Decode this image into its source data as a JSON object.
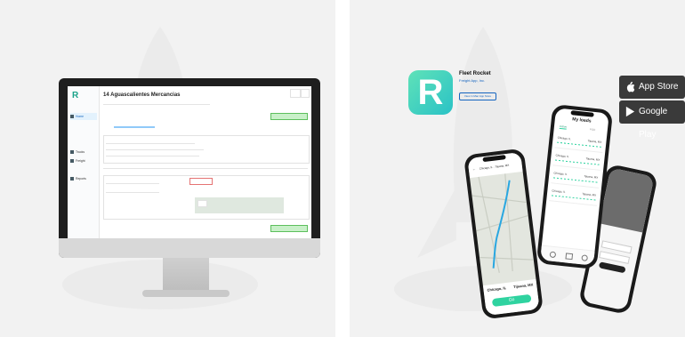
{
  "colors": {
    "brand": "#2fd3a0",
    "dark_panel": "#3a3a3a",
    "link": "#1565c0",
    "panel_bg": "#f2f2f2"
  },
  "desktop": {
    "page_title": "14 Aguascalientes Mercancias",
    "sidebar": [
      {
        "label": "Home",
        "active": true,
        "icon": "home-icon"
      },
      {
        "label": "Trucks",
        "active": false,
        "icon": "truck-icon"
      },
      {
        "label": "Freight",
        "active": false,
        "icon": "package-icon"
      },
      {
        "label": "Reports",
        "active": false,
        "icon": "report-icon"
      }
    ]
  },
  "app_store": {
    "app_name": "Fleet Rocket",
    "subtitle": "Freight App, Inc.",
    "view_button": "View in Mac App Store"
  },
  "store_buttons": [
    {
      "label": "App Store",
      "icon": "apple-icon"
    },
    {
      "label": "Google Play",
      "icon": "play-icon"
    }
  ],
  "phone_center": {
    "title": "My loads",
    "tab": "Active",
    "tab2": "POD",
    "loads": [
      {
        "origin": "Chicago, IL",
        "destination": "Tijuana, MX"
      },
      {
        "origin": "Chicago, IL",
        "destination": "Tijuana, MX"
      },
      {
        "origin": "Chicago, IL",
        "destination": "Tijuana, MX"
      },
      {
        "origin": "Chicago, IL",
        "destination": "Tijuana, MX"
      }
    ]
  },
  "phone_left": {
    "header": "Chicago, IL - Tijuana, MX",
    "origin": "Chicago, IL",
    "destination": "Tijuana, MX",
    "go_button": "Go"
  }
}
